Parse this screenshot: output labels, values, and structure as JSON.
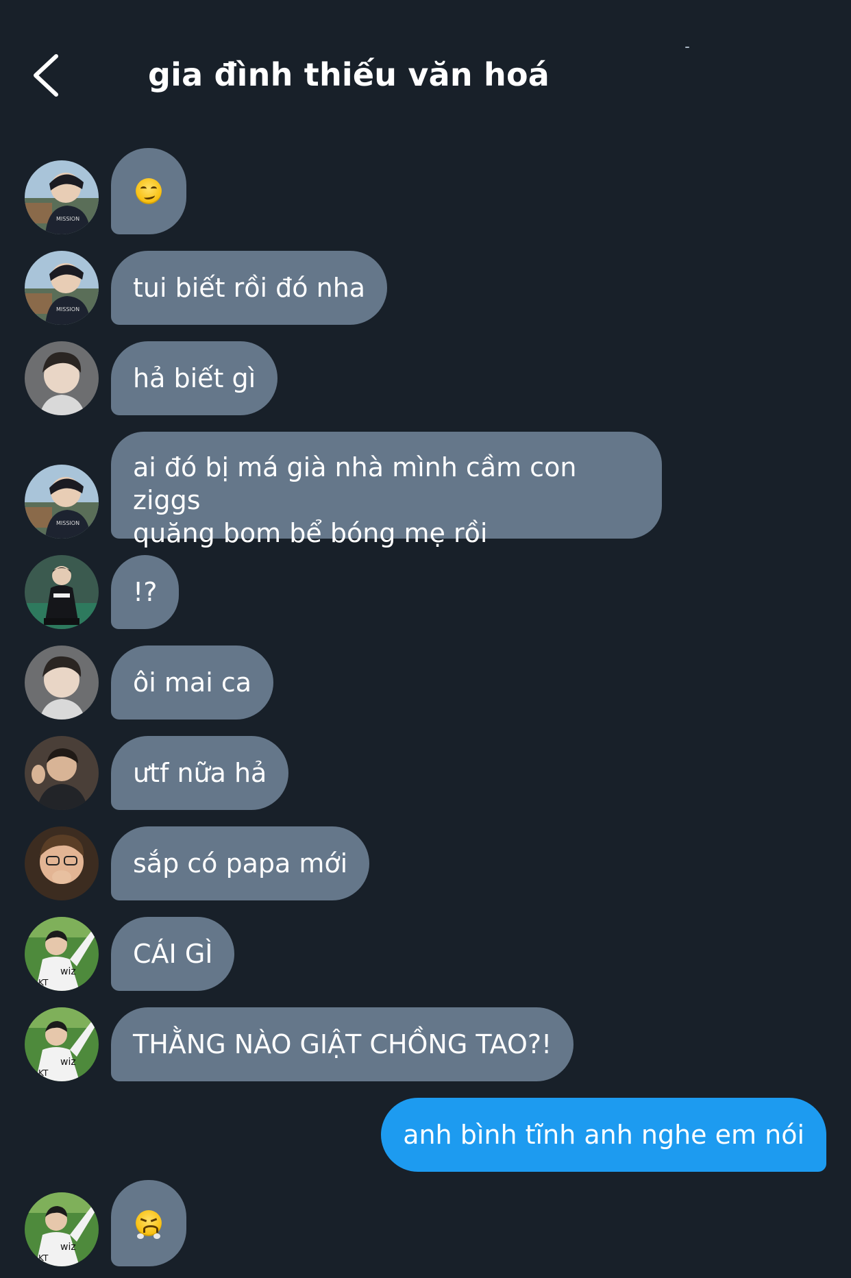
{
  "header": {
    "title": "gia đình thiếu văn hoá",
    "back_icon": "chevron-left-icon"
  },
  "colors": {
    "background": "#182029",
    "incoming_bubble": "#65778a",
    "outgoing_bubble": "#1d9bf0",
    "text": "#ffffff"
  },
  "messages": [
    {
      "sender": "user-a",
      "type": "emoji",
      "emoji": "smirk-emoji",
      "text": "😏"
    },
    {
      "sender": "user-a",
      "type": "text",
      "text": "tui biết rồi đó nha"
    },
    {
      "sender": "user-b",
      "type": "text",
      "text": "hả biết gì"
    },
    {
      "sender": "user-a",
      "type": "text",
      "lines": [
        "ai đó bị má già nhà mình cầm con ziggs",
        "quăng bom bể bóng mẹ rồi"
      ]
    },
    {
      "sender": "user-c",
      "type": "text",
      "text": "!?"
    },
    {
      "sender": "user-b",
      "type": "text",
      "text": "ôi mai ca"
    },
    {
      "sender": "user-d",
      "type": "text",
      "text": "ưtf nữa hả"
    },
    {
      "sender": "user-e",
      "type": "text",
      "text": "sắp có papa mới"
    },
    {
      "sender": "user-f",
      "type": "text",
      "text": "CÁI GÌ"
    },
    {
      "sender": "user-f",
      "type": "text",
      "text": "THẰNG NÀO GIẬT CHỒNG TAO?!"
    },
    {
      "sender": "me",
      "type": "text",
      "text": "anh bình tĩnh anh nghe em nói"
    },
    {
      "sender": "user-f",
      "type": "emoji",
      "emoji": "angry-huff-emoji",
      "text": "😤"
    }
  ]
}
